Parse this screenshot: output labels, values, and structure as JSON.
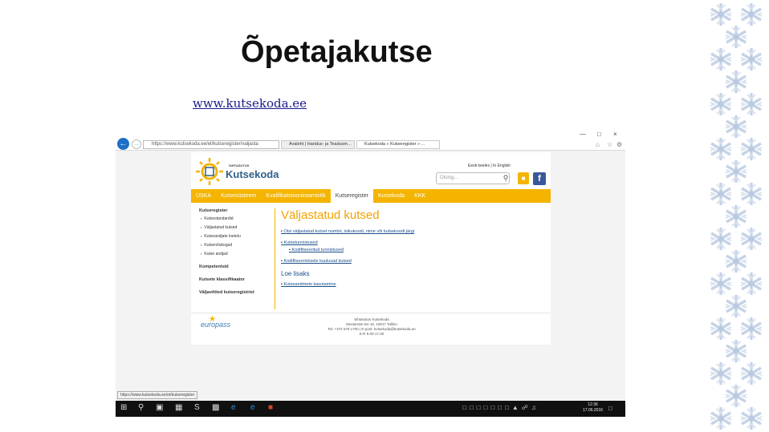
{
  "slide": {
    "title": "Õpetajakutse",
    "link": "www.kutsekoda.ee"
  },
  "browser": {
    "address": "https://www.kutsekoda.ee/et/kutseregister/valjasta",
    "tabs": [
      "Avaleht | Haridus- ja Teadusm...",
      "Kutsekoda » Kutseregister » ..."
    ],
    "window_controls": [
      "—",
      "□",
      "×"
    ]
  },
  "site": {
    "logo_small": "SIHTASUTUS",
    "logo_name": "Kutsekoda",
    "lang": "Eesti keeles | In English",
    "search_placeholder": "Otsing...",
    "nav": [
      "ÜSKA",
      "Kutsesüsteem",
      "Kvalifikatsiooniraamistik",
      "Kutseregister",
      "Kutsekoda",
      "KKK"
    ],
    "nav_active": "Kutseregister",
    "sidebar": {
      "heading": "Kutseregister",
      "items": [
        "Kutsestandardid",
        "Väljastatud kutsed",
        "Kutseandjate loetelu",
        "Kutsenõukogud",
        "Kutse andjad"
      ],
      "groups": [
        "Kompetentsid",
        "Kutsete klassifikaator",
        "Väljavõtted kutseregistrist"
      ]
    },
    "content": {
      "title": "Väljastatud kutsed",
      "links": [
        "Otsi väljastatud kutset numbri, isikukoodi, nime või kutsekoodi järgi",
        "Kutsetunnistused",
        "Kodifitseeritud tunnistused",
        "Kodifitseerimisele kuuluvad kutsed"
      ],
      "more_title": "Loe lisaks",
      "more_links": [
        "Kutseandmete kasutamine"
      ]
    },
    "footer": {
      "europass": "europass",
      "lines": [
        "Sihtasutus Kutsekoda",
        "Mustamäe tee 16, 10617 Tallinn",
        "Tel: +372 679 1700 | E-post: kutsekoda@kutsekoda.ee",
        "E-R 9.00-17.00"
      ]
    }
  },
  "status_url": "https://www.kutsekoda.ee/et/kutseregister",
  "taskbar": {
    "clock_time": "12:36",
    "clock_date": "17.06.2016"
  }
}
